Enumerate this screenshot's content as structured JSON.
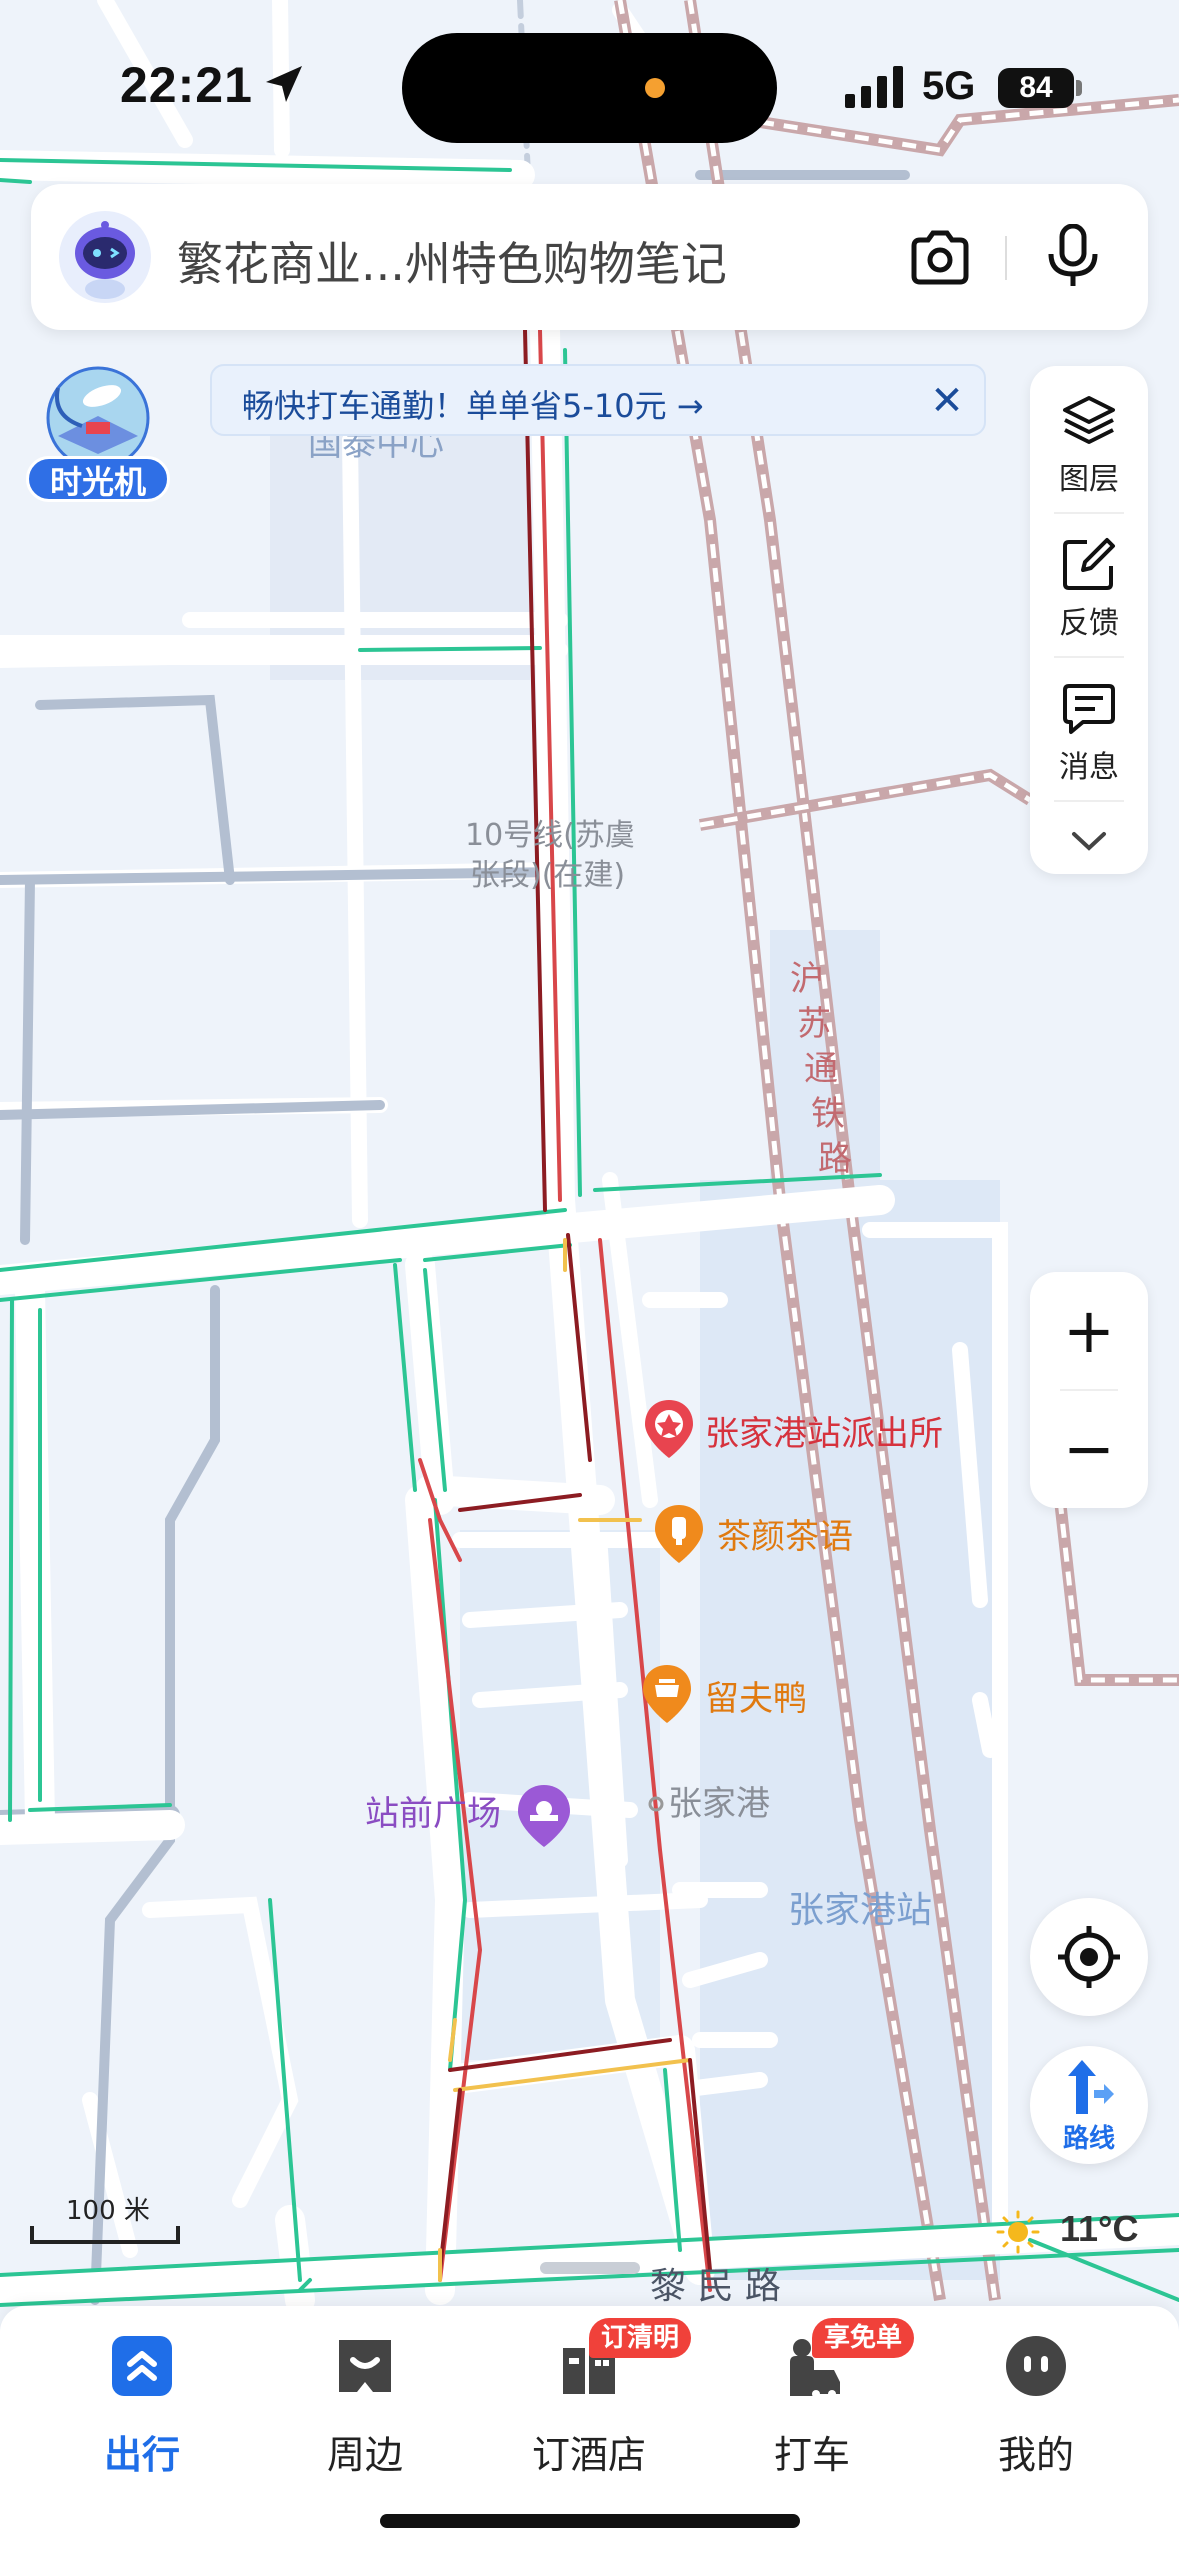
{
  "status_bar": {
    "time": "22:21",
    "network": "5G",
    "battery": "84"
  },
  "search": {
    "text": "繁花商业...州特色购物笔记"
  },
  "time_machine": {
    "label": "时光机"
  },
  "banner": {
    "text": "畅快打车通勤！单单省5-10元 →",
    "close": "✕"
  },
  "tools": [
    {
      "label": "图层",
      "icon": "layers-icon"
    },
    {
      "label": "反馈",
      "icon": "feedback-icon"
    },
    {
      "label": "消息",
      "icon": "message-icon"
    }
  ],
  "zoom": {
    "in": "+",
    "out": "−"
  },
  "route": {
    "label": "路线"
  },
  "weather": {
    "temp": "11°C"
  },
  "scale": {
    "label": "100 米"
  },
  "map": {
    "labels": {
      "guotai": "国泰中心",
      "line10_a": "10号线(苏虞",
      "line10_b": "张段)(在建)",
      "railway": [
        "沪",
        "苏",
        "通",
        "铁",
        "路"
      ],
      "police": "张家港站派出所",
      "tea": "茶颜茶语",
      "duck": "留夫鸭",
      "plaza": "站前广场",
      "zjg": "张家港",
      "station": "张家港站",
      "road": "黎 民 路"
    }
  },
  "nav": [
    {
      "label": "出行",
      "icon": "travel-icon",
      "active": true
    },
    {
      "label": "周边",
      "icon": "nearby-icon"
    },
    {
      "label": "订酒店",
      "icon": "hotel-icon",
      "badge": "订清明"
    },
    {
      "label": "打车",
      "icon": "taxi-icon",
      "badge": "享免单"
    },
    {
      "label": "我的",
      "icon": "profile-icon"
    }
  ],
  "colors": {
    "accent": "#1f6ee8",
    "road_green": "#2cc594",
    "road_red": "#d8474a",
    "road_darkred": "#8c1c22",
    "road_yellow": "#f2c14e",
    "badge": "#f0413a",
    "map_bg": "#eef3fa"
  }
}
